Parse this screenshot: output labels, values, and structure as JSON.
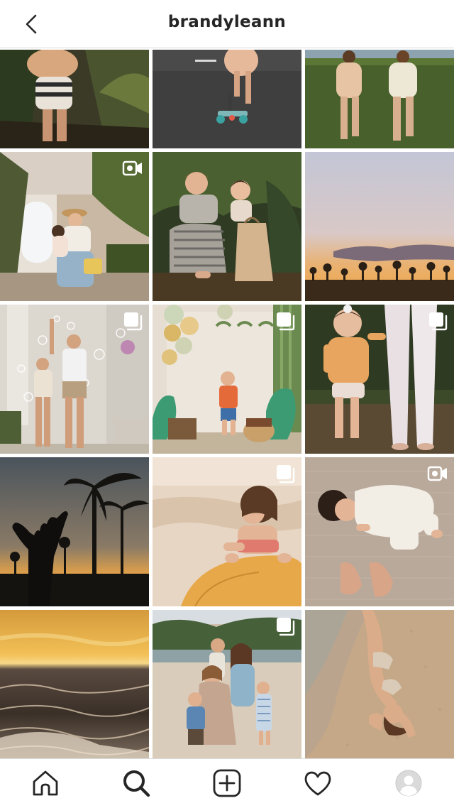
{
  "header": {
    "username": "brandyleann",
    "back_icon": "chevron-left-icon"
  },
  "grid": {
    "posts": [
      {
        "id": 1,
        "scene": "toddler-standing-among-palms",
        "badge": ""
      },
      {
        "id": 2,
        "scene": "toddler-on-scooter-asphalt",
        "badge": ""
      },
      {
        "id": 3,
        "scene": "two-kids-walking-in-grass",
        "badge": ""
      },
      {
        "id": 4,
        "scene": "mother-holding-baby-outside-house",
        "badge": "video-icon"
      },
      {
        "id": 5,
        "scene": "mother-crouching-with-toddler",
        "badge": ""
      },
      {
        "id": 6,
        "scene": "sunset-over-palm-tree-line",
        "badge": ""
      },
      {
        "id": 7,
        "scene": "boys-playing-with-bubbles",
        "badge": "carousel-icon"
      },
      {
        "id": 8,
        "scene": "dinosaur-birthday-party-backdrop",
        "badge": "carousel-icon"
      },
      {
        "id": 9,
        "scene": "toddler-beside-mother-legs",
        "badge": "carousel-icon"
      },
      {
        "id": 10,
        "scene": "shaka-hand-palm-silhouette",
        "badge": ""
      },
      {
        "id": 11,
        "scene": "toddler-on-surfboard",
        "badge": "carousel-icon"
      },
      {
        "id": 12,
        "scene": "baby-crawling-on-rug",
        "badge": "video-icon"
      },
      {
        "id": 13,
        "scene": "golden-sunset-ocean-waves",
        "badge": ""
      },
      {
        "id": 14,
        "scene": "family-portrait-on-beach",
        "badge": "carousel-icon"
      },
      {
        "id": 15,
        "scene": "woman-lying-in-sand",
        "badge": ""
      }
    ]
  },
  "tabbar": {
    "items": [
      {
        "name": "tab-home",
        "icon": "home-icon"
      },
      {
        "name": "tab-search",
        "icon": "search-icon"
      },
      {
        "name": "tab-new-post",
        "icon": "plus-square-icon"
      },
      {
        "name": "tab-activity",
        "icon": "heart-icon"
      },
      {
        "name": "tab-profile",
        "icon": "avatar-icon"
      }
    ]
  },
  "colors": {
    "text": "#262626",
    "divider": "#dbdbdb",
    "background": "#ffffff",
    "avatar_placeholder": "#c7c7c7"
  }
}
